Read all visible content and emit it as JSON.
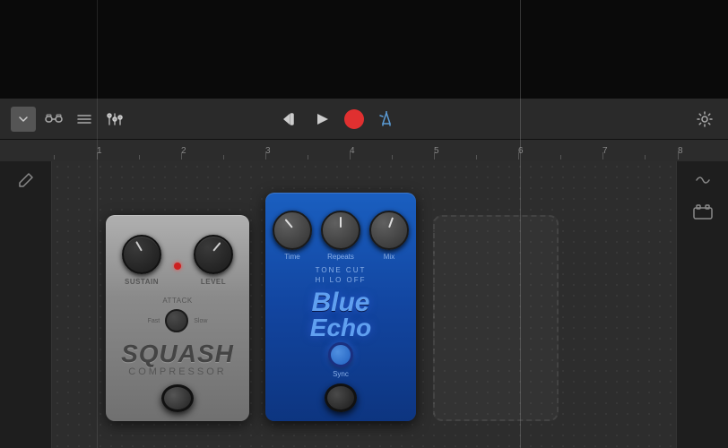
{
  "toolbar": {
    "dropdown_label": "▼",
    "play_label": "▶",
    "plus_label": "+",
    "icons": {
      "chain": "chain-icon",
      "list": "list-icon",
      "mixer": "mixer-icon",
      "rewind": "rewind-icon",
      "play": "play-icon",
      "record": "record-icon",
      "tune": "tune-icon",
      "gear": "gear-icon"
    }
  },
  "ruler": {
    "marks": [
      "1",
      "2",
      "3",
      "4",
      "5",
      "6",
      "7",
      "8"
    ]
  },
  "pedalboard": {
    "squash": {
      "name": "SQUASH",
      "subtitle": "COMPRESSOR",
      "knob1_label": "SUSTAIN",
      "knob2_label": "LEVEL",
      "attack_label": "ATTACK",
      "attack_fast": "Fast",
      "attack_slow": "Slow"
    },
    "blue_echo": {
      "knob1_label": "Time",
      "knob2_label": "Repeats",
      "knob3_label": "Mix",
      "switch1_label": "TONE CUT",
      "switch2_label": "HI LO OFF",
      "title_blue": "Blue",
      "title_echo": "Echo",
      "sync_label": "Sync"
    }
  }
}
